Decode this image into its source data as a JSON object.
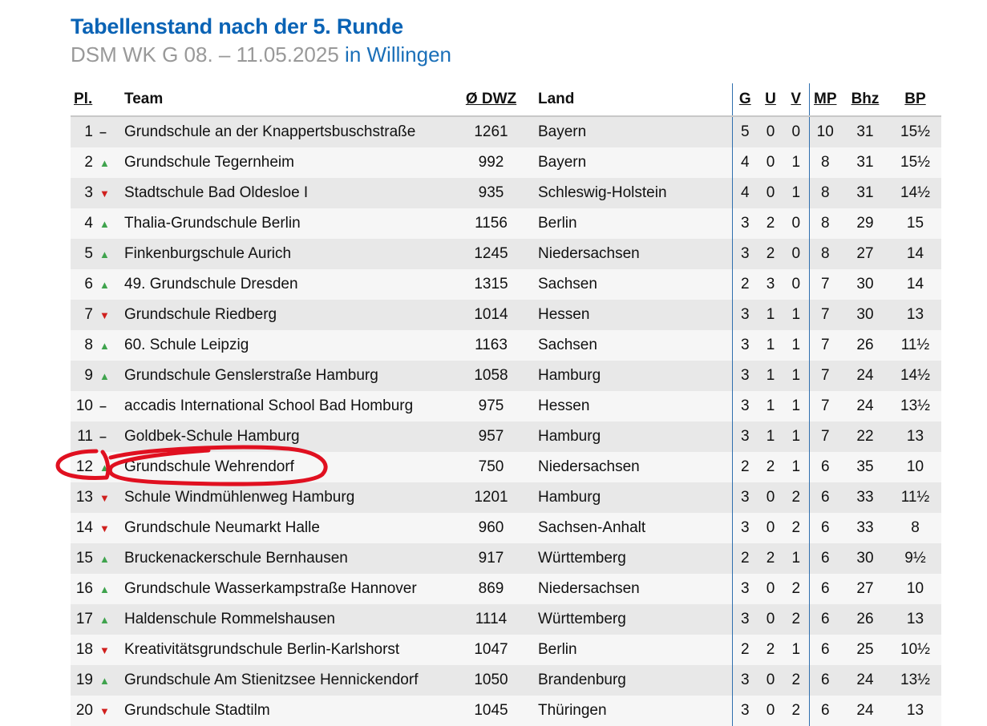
{
  "title": "Tabellenstand nach der 5. Runde",
  "subtitle": {
    "event": "DSM WK G 08. – 11.05.2025",
    "location": "in Willingen"
  },
  "colors": {
    "link": "#4f7fb8",
    "muted": "#9a9a9a",
    "heading": "#0a63b5",
    "trend_up": "#3fa34d",
    "trend_down": "#d0201e",
    "annotation": "#e01020"
  },
  "table": {
    "headers": {
      "pl": "Pl.",
      "team": "Team",
      "dwz": "Ø DWZ",
      "land": "Land",
      "g": "G",
      "u": "U",
      "v": "V",
      "mp": "MP",
      "bhz": "Bhz",
      "bp": "BP"
    },
    "rows": [
      {
        "pl": "1",
        "trend": "same",
        "team": "Grundschule an der Knappertsbuschstraße",
        "team_link": true,
        "dwz": "1261",
        "land": "Bayern",
        "land_link": true,
        "g": "5",
        "u": "0",
        "v": "0",
        "mp": "10",
        "bhz": "31",
        "bp": "15½"
      },
      {
        "pl": "2",
        "trend": "up",
        "team": "Grundschule Tegernheim",
        "team_link": true,
        "dwz": "992",
        "land": "Bayern",
        "land_link": true,
        "g": "4",
        "u": "0",
        "v": "1",
        "mp": "8",
        "bhz": "31",
        "bp": "15½"
      },
      {
        "pl": "3",
        "trend": "down",
        "team": "Stadtschule Bad Oldesloe I",
        "team_link": false,
        "dwz": "935",
        "land": "Schleswig-Holstein",
        "land_link": false,
        "g": "4",
        "u": "0",
        "v": "1",
        "mp": "8",
        "bhz": "31",
        "bp": "14½"
      },
      {
        "pl": "4",
        "trend": "up",
        "team": "Thalia-Grundschule Berlin",
        "team_link": false,
        "dwz": "1156",
        "land": "Berlin",
        "land_link": true,
        "g": "3",
        "u": "2",
        "v": "0",
        "mp": "8",
        "bhz": "29",
        "bp": "15"
      },
      {
        "pl": "5",
        "trend": "up",
        "team": "Finkenburgschule Aurich",
        "team_link": false,
        "dwz": "1245",
        "land": "Niedersachsen",
        "land_link": false,
        "g": "3",
        "u": "2",
        "v": "0",
        "mp": "8",
        "bhz": "27",
        "bp": "14"
      },
      {
        "pl": "6",
        "trend": "up",
        "team": "49. Grundschule Dresden",
        "team_link": false,
        "dwz": "1315",
        "land": "Sachsen",
        "land_link": false,
        "g": "2",
        "u": "3",
        "v": "0",
        "mp": "7",
        "bhz": "30",
        "bp": "14"
      },
      {
        "pl": "7",
        "trend": "down",
        "team": "Grundschule Riedberg",
        "team_link": true,
        "dwz": "1014",
        "land": "Hessen",
        "land_link": true,
        "g": "3",
        "u": "1",
        "v": "1",
        "mp": "7",
        "bhz": "30",
        "bp": "13"
      },
      {
        "pl": "8",
        "trend": "up",
        "team": "60. Schule Leipzig",
        "team_link": false,
        "dwz": "1163",
        "land": "Sachsen",
        "land_link": false,
        "g": "3",
        "u": "1",
        "v": "1",
        "mp": "7",
        "bhz": "26",
        "bp": "11½"
      },
      {
        "pl": "9",
        "trend": "up",
        "team": "Grundschule Genslerstraße Hamburg",
        "team_link": true,
        "dwz": "1058",
        "land": "Hamburg",
        "land_link": true,
        "g": "3",
        "u": "1",
        "v": "1",
        "mp": "7",
        "bhz": "24",
        "bp": "14½"
      },
      {
        "pl": "10",
        "trend": "same",
        "team": "accadis International School Bad Homburg",
        "team_link": false,
        "dwz": "975",
        "land": "Hessen",
        "land_link": true,
        "g": "3",
        "u": "1",
        "v": "1",
        "mp": "7",
        "bhz": "24",
        "bp": "13½"
      },
      {
        "pl": "11",
        "trend": "same",
        "team": "Goldbek-Schule Hamburg",
        "team_link": true,
        "dwz": "957",
        "land": "Hamburg",
        "land_link": true,
        "g": "3",
        "u": "1",
        "v": "1",
        "mp": "7",
        "bhz": "22",
        "bp": "13"
      },
      {
        "pl": "12",
        "trend": "up",
        "team": "Grundschule Wehrendorf",
        "team_link": false,
        "dwz": "750",
        "land": "Niedersachsen",
        "land_link": false,
        "g": "2",
        "u": "2",
        "v": "1",
        "mp": "6",
        "bhz": "35",
        "bp": "10"
      },
      {
        "pl": "13",
        "trend": "down",
        "team": "Schule Windmühlenweg Hamburg",
        "team_link": true,
        "dwz": "1201",
        "land": "Hamburg",
        "land_link": true,
        "g": "3",
        "u": "0",
        "v": "2",
        "mp": "6",
        "bhz": "33",
        "bp": "11½"
      },
      {
        "pl": "14",
        "trend": "down",
        "team": "Grundschule Neumarkt Halle",
        "team_link": true,
        "dwz": "960",
        "land": "Sachsen-Anhalt",
        "land_link": true,
        "g": "3",
        "u": "0",
        "v": "2",
        "mp": "6",
        "bhz": "33",
        "bp": "8"
      },
      {
        "pl": "15",
        "trend": "up",
        "team": "Bruckenackerschule Bernhausen",
        "team_link": true,
        "dwz": "917",
        "land": "Württemberg",
        "land_link": false,
        "g": "2",
        "u": "2",
        "v": "1",
        "mp": "6",
        "bhz": "30",
        "bp": "9½"
      },
      {
        "pl": "16",
        "trend": "up",
        "team": "Grundschule Wasserkampstraße Hannover",
        "team_link": false,
        "dwz": "869",
        "land": "Niedersachsen",
        "land_link": false,
        "g": "3",
        "u": "0",
        "v": "2",
        "mp": "6",
        "bhz": "27",
        "bp": "10"
      },
      {
        "pl": "17",
        "trend": "up",
        "team": "Haldenschule Rommelshausen",
        "team_link": false,
        "dwz": "1114",
        "land": "Württemberg",
        "land_link": false,
        "g": "3",
        "u": "0",
        "v": "2",
        "mp": "6",
        "bhz": "26",
        "bp": "13"
      },
      {
        "pl": "18",
        "trend": "down",
        "team": "Kreativitätsgrundschule Berlin-Karlshorst",
        "team_link": false,
        "dwz": "1047",
        "land": "Berlin",
        "land_link": true,
        "g": "2",
        "u": "2",
        "v": "1",
        "mp": "6",
        "bhz": "25",
        "bp": "10½"
      },
      {
        "pl": "19",
        "trend": "up",
        "team": "Grundschule Am Stienitzsee Hennickendorf",
        "team_link": true,
        "dwz": "1050",
        "land": "Brandenburg",
        "land_link": true,
        "g": "3",
        "u": "0",
        "v": "2",
        "mp": "6",
        "bhz": "24",
        "bp": "13½"
      },
      {
        "pl": "20",
        "trend": "down",
        "team": "Grundschule Stadtilm",
        "team_link": false,
        "dwz": "1045",
        "land": "Thüringen",
        "land_link": true,
        "g": "3",
        "u": "0",
        "v": "2",
        "mp": "6",
        "bhz": "24",
        "bp": "13"
      }
    ]
  }
}
